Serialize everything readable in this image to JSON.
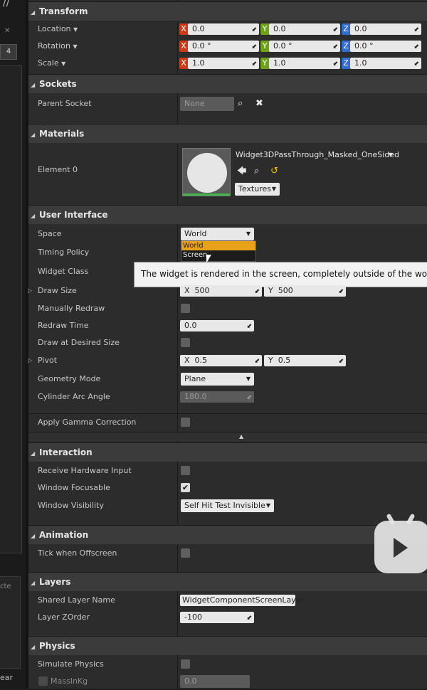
{
  "left_panel": {
    "badge": "4",
    "footer_text": "ear",
    "panel_text": "cte"
  },
  "sections": {
    "transform": "Transform",
    "sockets": "Sockets",
    "materials": "Materials",
    "user_interface": "User Interface",
    "interaction": "Interaction",
    "animation": "Animation",
    "layers": "Layers",
    "physics": "Physics"
  },
  "transform": {
    "location": {
      "label": "Location",
      "x": "0.0",
      "y": "0.0",
      "z": "0.0"
    },
    "rotation": {
      "label": "Rotation",
      "x": "0.0 °",
      "y": "0.0 °",
      "z": "0.0 °"
    },
    "scale": {
      "label": "Scale",
      "x": "1.0",
      "y": "1.0",
      "z": "1.0"
    },
    "axes": {
      "x": "X",
      "y": "Y",
      "z": "Z"
    }
  },
  "sockets": {
    "parent_socket_label": "Parent Socket",
    "parent_socket_value": "None"
  },
  "materials": {
    "element0_label": "Element 0",
    "material_name": "Widget3DPassThrough_Masked_OneSided",
    "textures_label": "Textures"
  },
  "user_interface": {
    "space_label": "Space",
    "space_value": "World",
    "space_options": [
      "World",
      "Screen"
    ],
    "timing_policy_label": "Timing Policy",
    "widget_class_label": "Widget Class",
    "tooltip": "The widget is rendered in the screen, completely outside of the world, never",
    "draw_size_label": "Draw Size",
    "draw_size_x": "500",
    "draw_size_y": "500",
    "manually_redraw_label": "Manually Redraw",
    "redraw_time_label": "Redraw Time",
    "redraw_time_value": "0.0",
    "draw_at_desired_size_label": "Draw at Desired Size",
    "pivot_label": "Pivot",
    "pivot_x": "0.5",
    "pivot_y": "0.5",
    "geometry_mode_label": "Geometry Mode",
    "geometry_mode_value": "Plane",
    "cylinder_arc_label": "Cylinder Arc Angle",
    "cylinder_arc_value": "180.0",
    "apply_gamma_label": "Apply Gamma Correction",
    "axis_x": "X",
    "axis_y": "Y"
  },
  "interaction": {
    "receive_hw_input_label": "Receive Hardware Input",
    "window_focusable_label": "Window Focusable",
    "window_focusable_checked": true,
    "window_visibility_label": "Window Visibility",
    "window_visibility_value": "Self Hit Test Invisible"
  },
  "animation": {
    "tick_offscreen_label": "Tick when Offscreen"
  },
  "layers": {
    "shared_layer_label": "Shared Layer Name",
    "shared_layer_value": "WidgetComponentScreenLayer",
    "layer_zorder_label": "Layer ZOrder",
    "layer_zorder_value": "-100"
  },
  "physics": {
    "simulate_label": "Simulate Physics",
    "mass_label": "MassInKg",
    "mass_value": "0.0"
  },
  "colors": {
    "axis_x": "#c83c1e",
    "axis_y": "#6ea21a",
    "axis_z": "#2f6dd3",
    "highlight": "#e8a21a",
    "panel_bg": "#2c2c2c"
  },
  "icons": {
    "browse": "search-icon",
    "clear": "close-icon",
    "use": "arrow-left-icon",
    "reset": "reset-icon"
  }
}
